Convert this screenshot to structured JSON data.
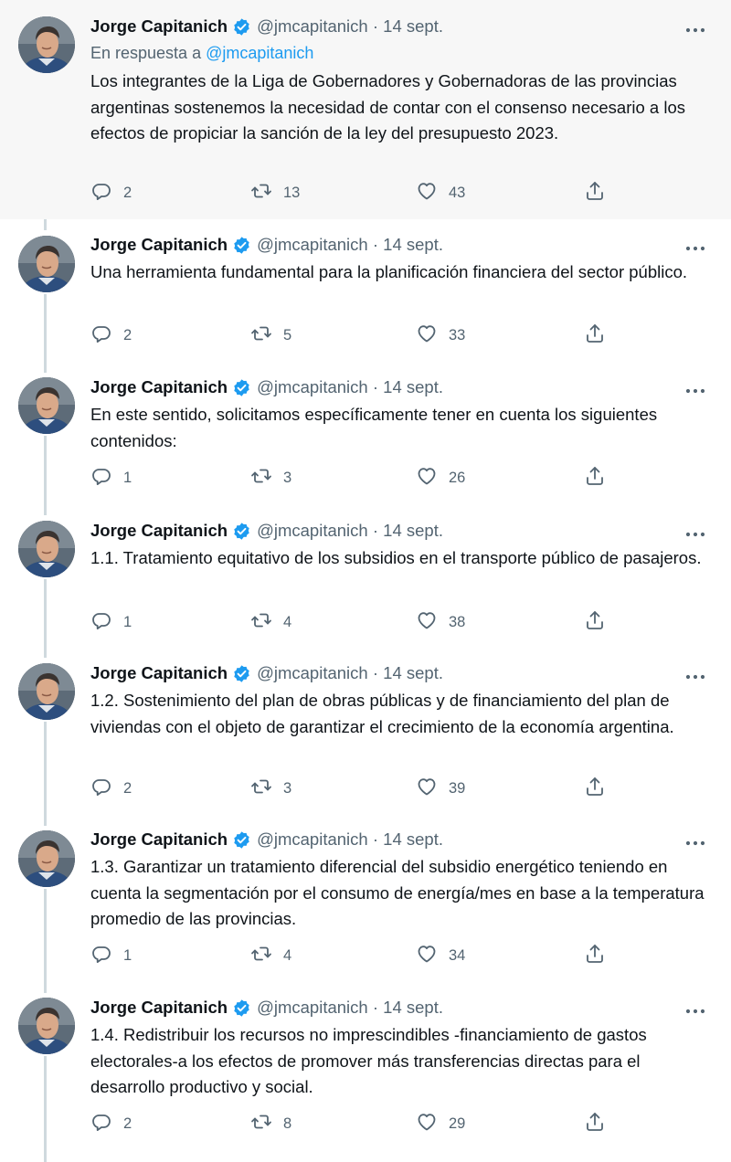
{
  "colors": {
    "accent": "#1d9bf0",
    "text_primary": "#0f1419",
    "text_secondary": "#536471",
    "thread_line": "#cfd9de",
    "highlight_bg": "#f7f7f7"
  },
  "icons": [
    "verified-badge-icon",
    "more-options-icon",
    "reply-icon",
    "retweet-icon",
    "like-icon",
    "share-icon"
  ],
  "tweets": [
    {
      "name": "Jorge Capitanich",
      "handle": "@jmcapitanich",
      "date": "14 sept.",
      "reply_prefix": "En respuesta a",
      "reply_mention": "@jmcapitanich",
      "text": "Los integrantes de la Liga de Gobernadores y Gobernadoras de las provincias argentinas sostenemos la necesidad de contar con el consenso necesario a los efectos de propiciar la sanción de la ley del presupuesto 2023.",
      "replies": "2",
      "retweets": "13",
      "likes": "43"
    },
    {
      "name": "Jorge Capitanich",
      "handle": "@jmcapitanich",
      "date": "14 sept.",
      "text": "Una herramienta fundamental para la planificación financiera del sector público.",
      "replies": "2",
      "retweets": "5",
      "likes": "33"
    },
    {
      "name": "Jorge Capitanich",
      "handle": "@jmcapitanich",
      "date": "14 sept.",
      "text": "En este sentido, solicitamos específicamente tener en cuenta los siguientes contenidos:",
      "replies": "1",
      "retweets": "3",
      "likes": "26"
    },
    {
      "name": "Jorge Capitanich",
      "handle": "@jmcapitanich",
      "date": "14 sept.",
      "text": "1.1. Tratamiento equitativo de los subsidios en el transporte público de pasajeros.",
      "replies": "1",
      "retweets": "4",
      "likes": "38"
    },
    {
      "name": "Jorge Capitanich",
      "handle": "@jmcapitanich",
      "date": "14 sept.",
      "text": "1.2. Sostenimiento del plan de obras públicas y de financiamiento del plan de viviendas con el objeto de garantizar el crecimiento de la economía argentina.",
      "replies": "2",
      "retweets": "3",
      "likes": "39"
    },
    {
      "name": "Jorge Capitanich",
      "handle": "@jmcapitanich",
      "date": "14 sept.",
      "text": "1.3. Garantizar un tratamiento diferencial del subsidio energético teniendo en cuenta la segmentación por el consumo de energía/mes en base a la temperatura promedio de las provincias.",
      "replies": "1",
      "retweets": "4",
      "likes": "34"
    },
    {
      "name": "Jorge Capitanich",
      "handle": "@jmcapitanich",
      "date": "14 sept.",
      "text": "1.4. Redistribuir los recursos no imprescindibles -financiamiento de gastos electorales-a los efectos de promover más transferencias directas para el desarrollo productivo y social.",
      "replies": "2",
      "retweets": "8",
      "likes": "29"
    }
  ]
}
